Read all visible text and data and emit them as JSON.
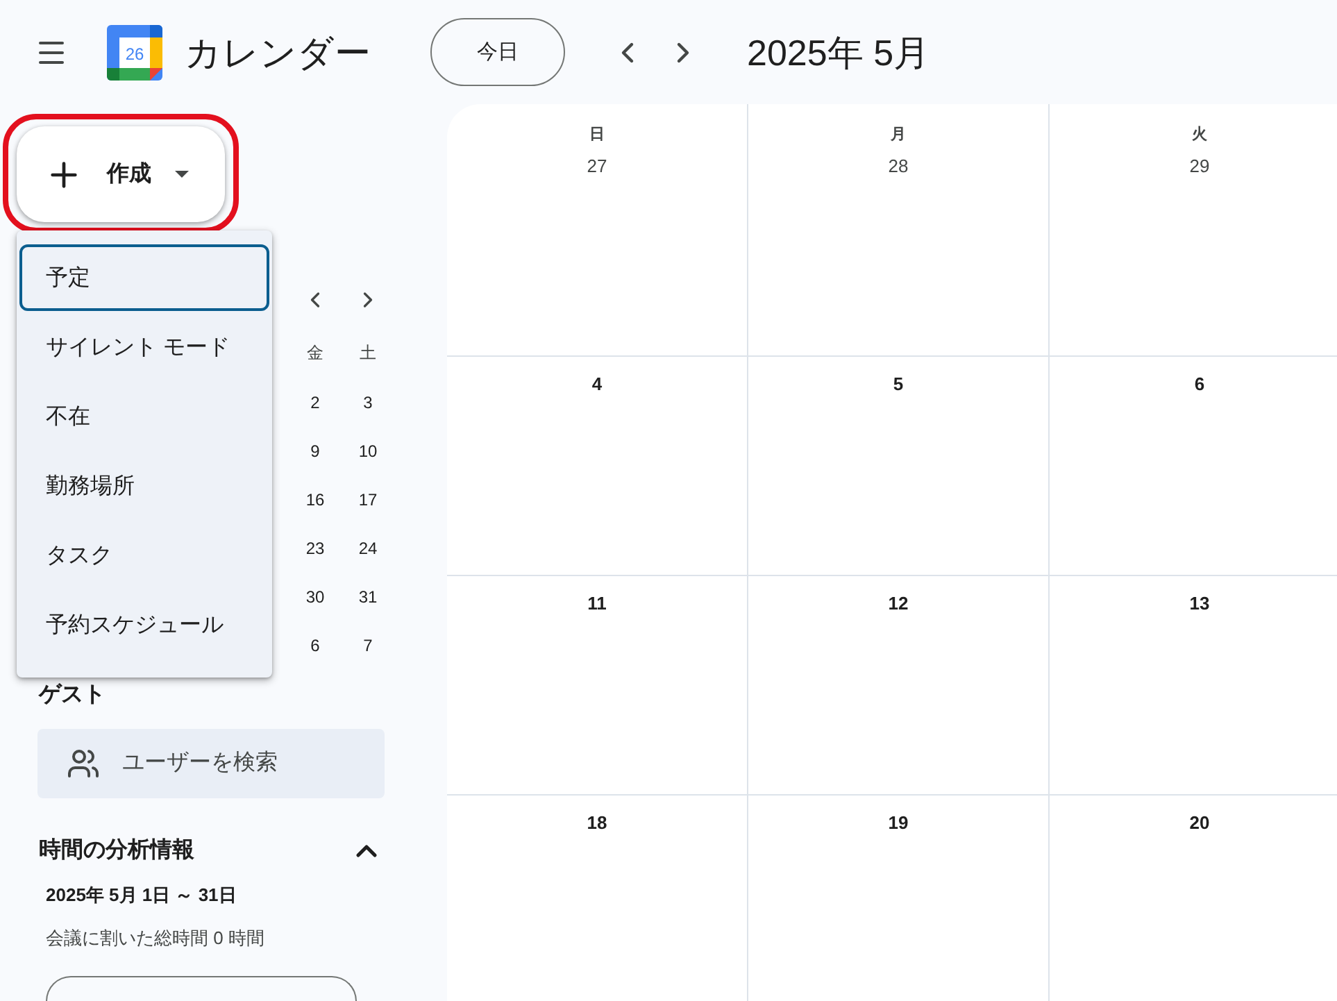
{
  "header": {
    "logo_text": "26",
    "title": "カレンダー",
    "today_button": "今日",
    "period": "2025年 5月"
  },
  "create_button": {
    "label": "作成",
    "highlighted": true
  },
  "create_menu": {
    "items": [
      {
        "label": "予定",
        "selected": true
      },
      {
        "label": "サイレント モード",
        "selected": false
      },
      {
        "label": "不在",
        "selected": false
      },
      {
        "label": "勤務場所",
        "selected": false
      },
      {
        "label": "タスク",
        "selected": false
      },
      {
        "label": "予約スケジュール",
        "selected": false
      }
    ]
  },
  "mini_calendar": {
    "weekdays": [
      "金",
      "土"
    ],
    "weeks": [
      [
        "2",
        "3"
      ],
      [
        "9",
        "10"
      ],
      [
        "16",
        "17"
      ],
      [
        "23",
        "24"
      ],
      [
        "30",
        "31"
      ],
      [
        "6",
        "7"
      ]
    ]
  },
  "guests": {
    "heading": "ゲスト",
    "search": {
      "placeholder": "ユーザーを検索"
    }
  },
  "time_insights": {
    "heading": "時間の分析情報",
    "expanded": true,
    "range": "2025年 5月 1日 ～ 31日",
    "summary": "会議に割いた総時間 0 時間"
  },
  "month_grid": {
    "weekdays": [
      "日",
      "月",
      "火"
    ],
    "weeks": [
      [
        {
          "day": "27",
          "outside_month": true
        },
        {
          "day": "28",
          "outside_month": true
        },
        {
          "day": "29",
          "outside_month": true
        }
      ],
      [
        {
          "day": "4",
          "outside_month": false
        },
        {
          "day": "5",
          "outside_month": false
        },
        {
          "day": "6",
          "outside_month": false
        }
      ],
      [
        {
          "day": "11",
          "outside_month": false
        },
        {
          "day": "12",
          "outside_month": false
        },
        {
          "day": "13",
          "outside_month": false
        }
      ],
      [
        {
          "day": "18",
          "outside_month": false
        },
        {
          "day": "19",
          "outside_month": false
        },
        {
          "day": "20",
          "outside_month": false
        }
      ]
    ]
  }
}
